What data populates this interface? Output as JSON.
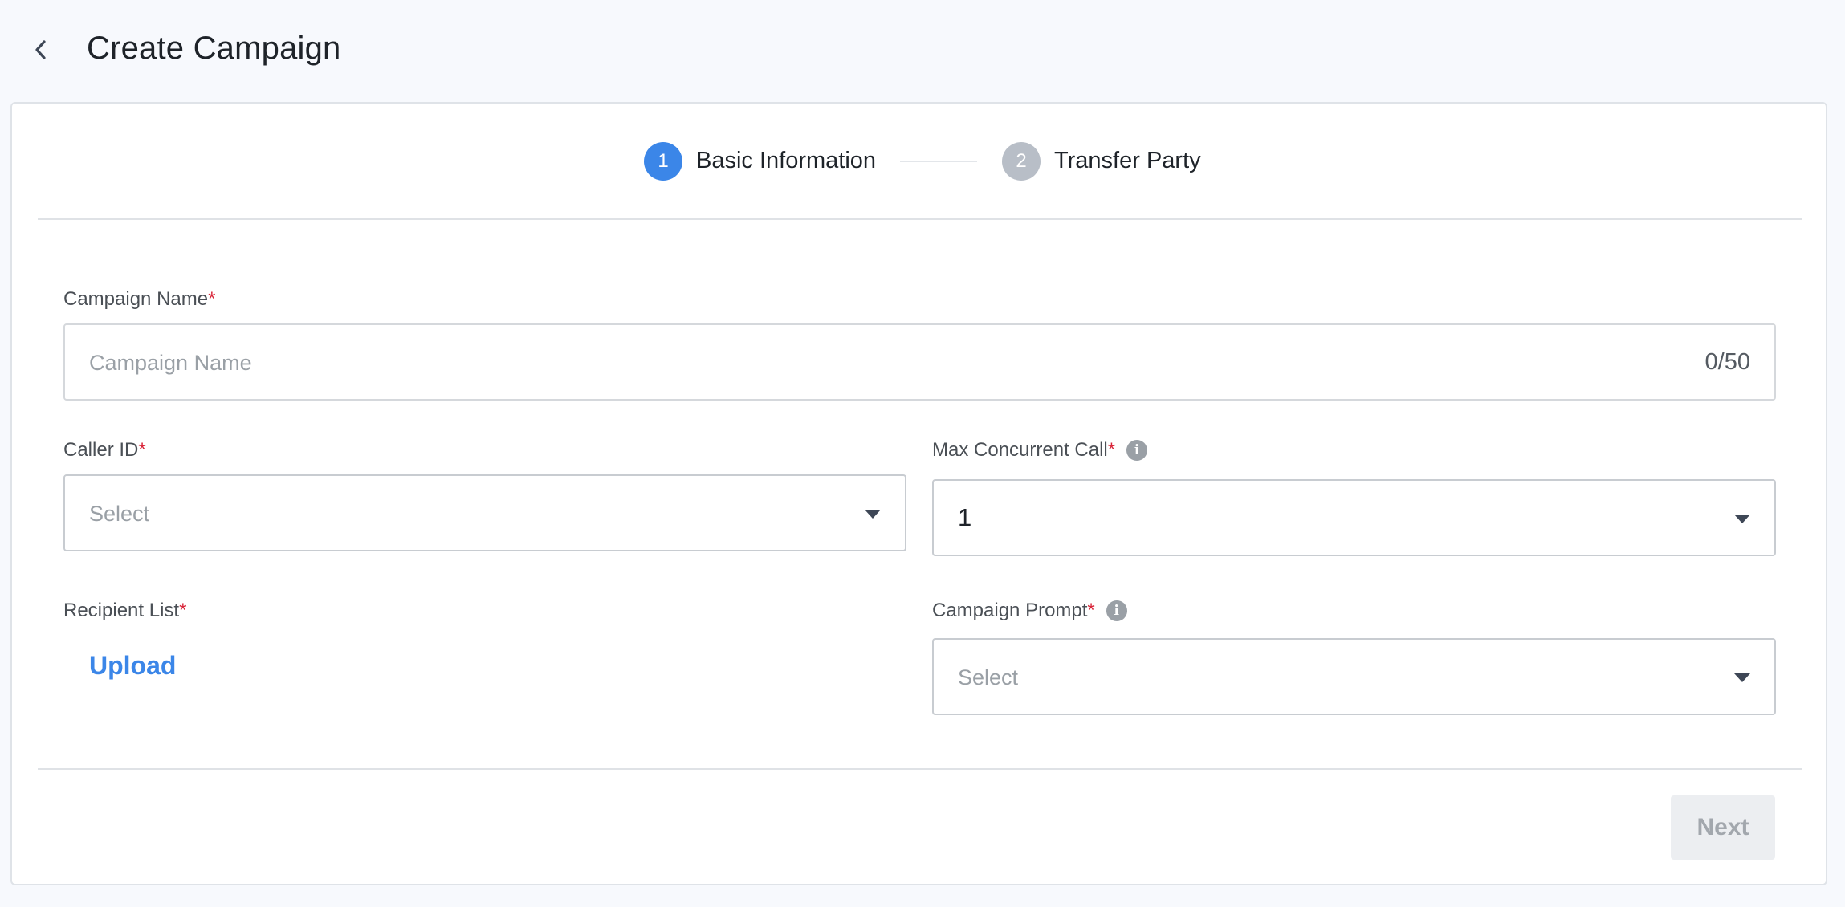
{
  "header": {
    "back_icon": "chevron-left-icon",
    "title": "Create Campaign"
  },
  "steps": [
    {
      "number": "1",
      "label": "Basic Information",
      "state": "active",
      "color": "#3b86e8"
    },
    {
      "number": "2",
      "label": "Transfer Party",
      "state": "inactive",
      "color": "#b8bec7"
    }
  ],
  "form": {
    "campaign_name": {
      "label": "Campaign Name",
      "required_mark": "*",
      "placeholder": "Campaign Name",
      "value": "",
      "counter": "0/50"
    },
    "caller_id": {
      "label": "Caller ID",
      "required_mark": "*",
      "placeholder": "Select",
      "value": ""
    },
    "max_concurrent_call": {
      "label": "Max Concurrent Call",
      "required_mark": "*",
      "info_icon": "i",
      "value": "1"
    },
    "recipient_list": {
      "label": "Recipient List",
      "required_mark": "*",
      "upload_label": "Upload"
    },
    "campaign_prompt": {
      "label": "Campaign Prompt",
      "required_mark": "*",
      "info_icon": "i",
      "placeholder": "Select",
      "value": ""
    }
  },
  "footer": {
    "next_label": "Next",
    "next_enabled": false
  },
  "colors": {
    "accent": "#3b86e8",
    "required": "#d9263a",
    "background": "#f7f9fd"
  }
}
